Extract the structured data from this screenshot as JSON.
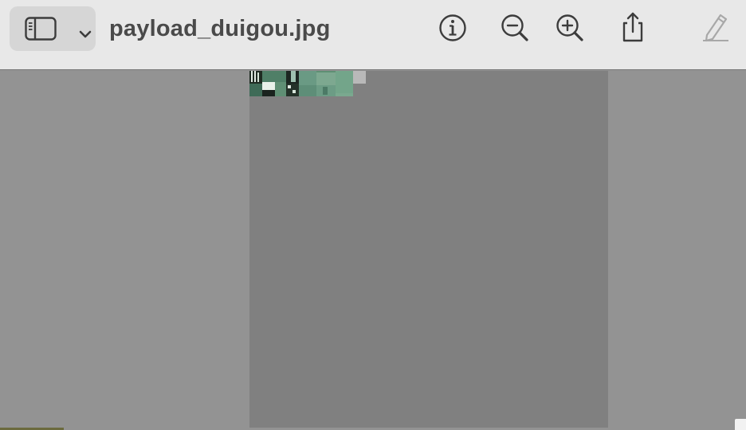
{
  "window": {
    "title": "payload_duigou.jpg"
  },
  "toolbar": {
    "sidebar_button": {
      "icon": "sidebar-icon",
      "dropdown_icon": "chevron-down-icon"
    },
    "buttons": [
      {
        "name": "info",
        "icon": "info-icon"
      },
      {
        "name": "zoom-out",
        "icon": "zoom-out-icon"
      },
      {
        "name": "zoom-in",
        "icon": "zoom-in-icon"
      },
      {
        "name": "share",
        "icon": "share-icon"
      },
      {
        "name": "markup",
        "icon": "pencil-icon"
      }
    ]
  },
  "colors": {
    "toolbar_bg": "#e8e8e8",
    "viewer_bg": "#939393",
    "page_bg": "#808080",
    "icon": "#3c3c3c",
    "icon_disabled": "#a8a8a8"
  }
}
